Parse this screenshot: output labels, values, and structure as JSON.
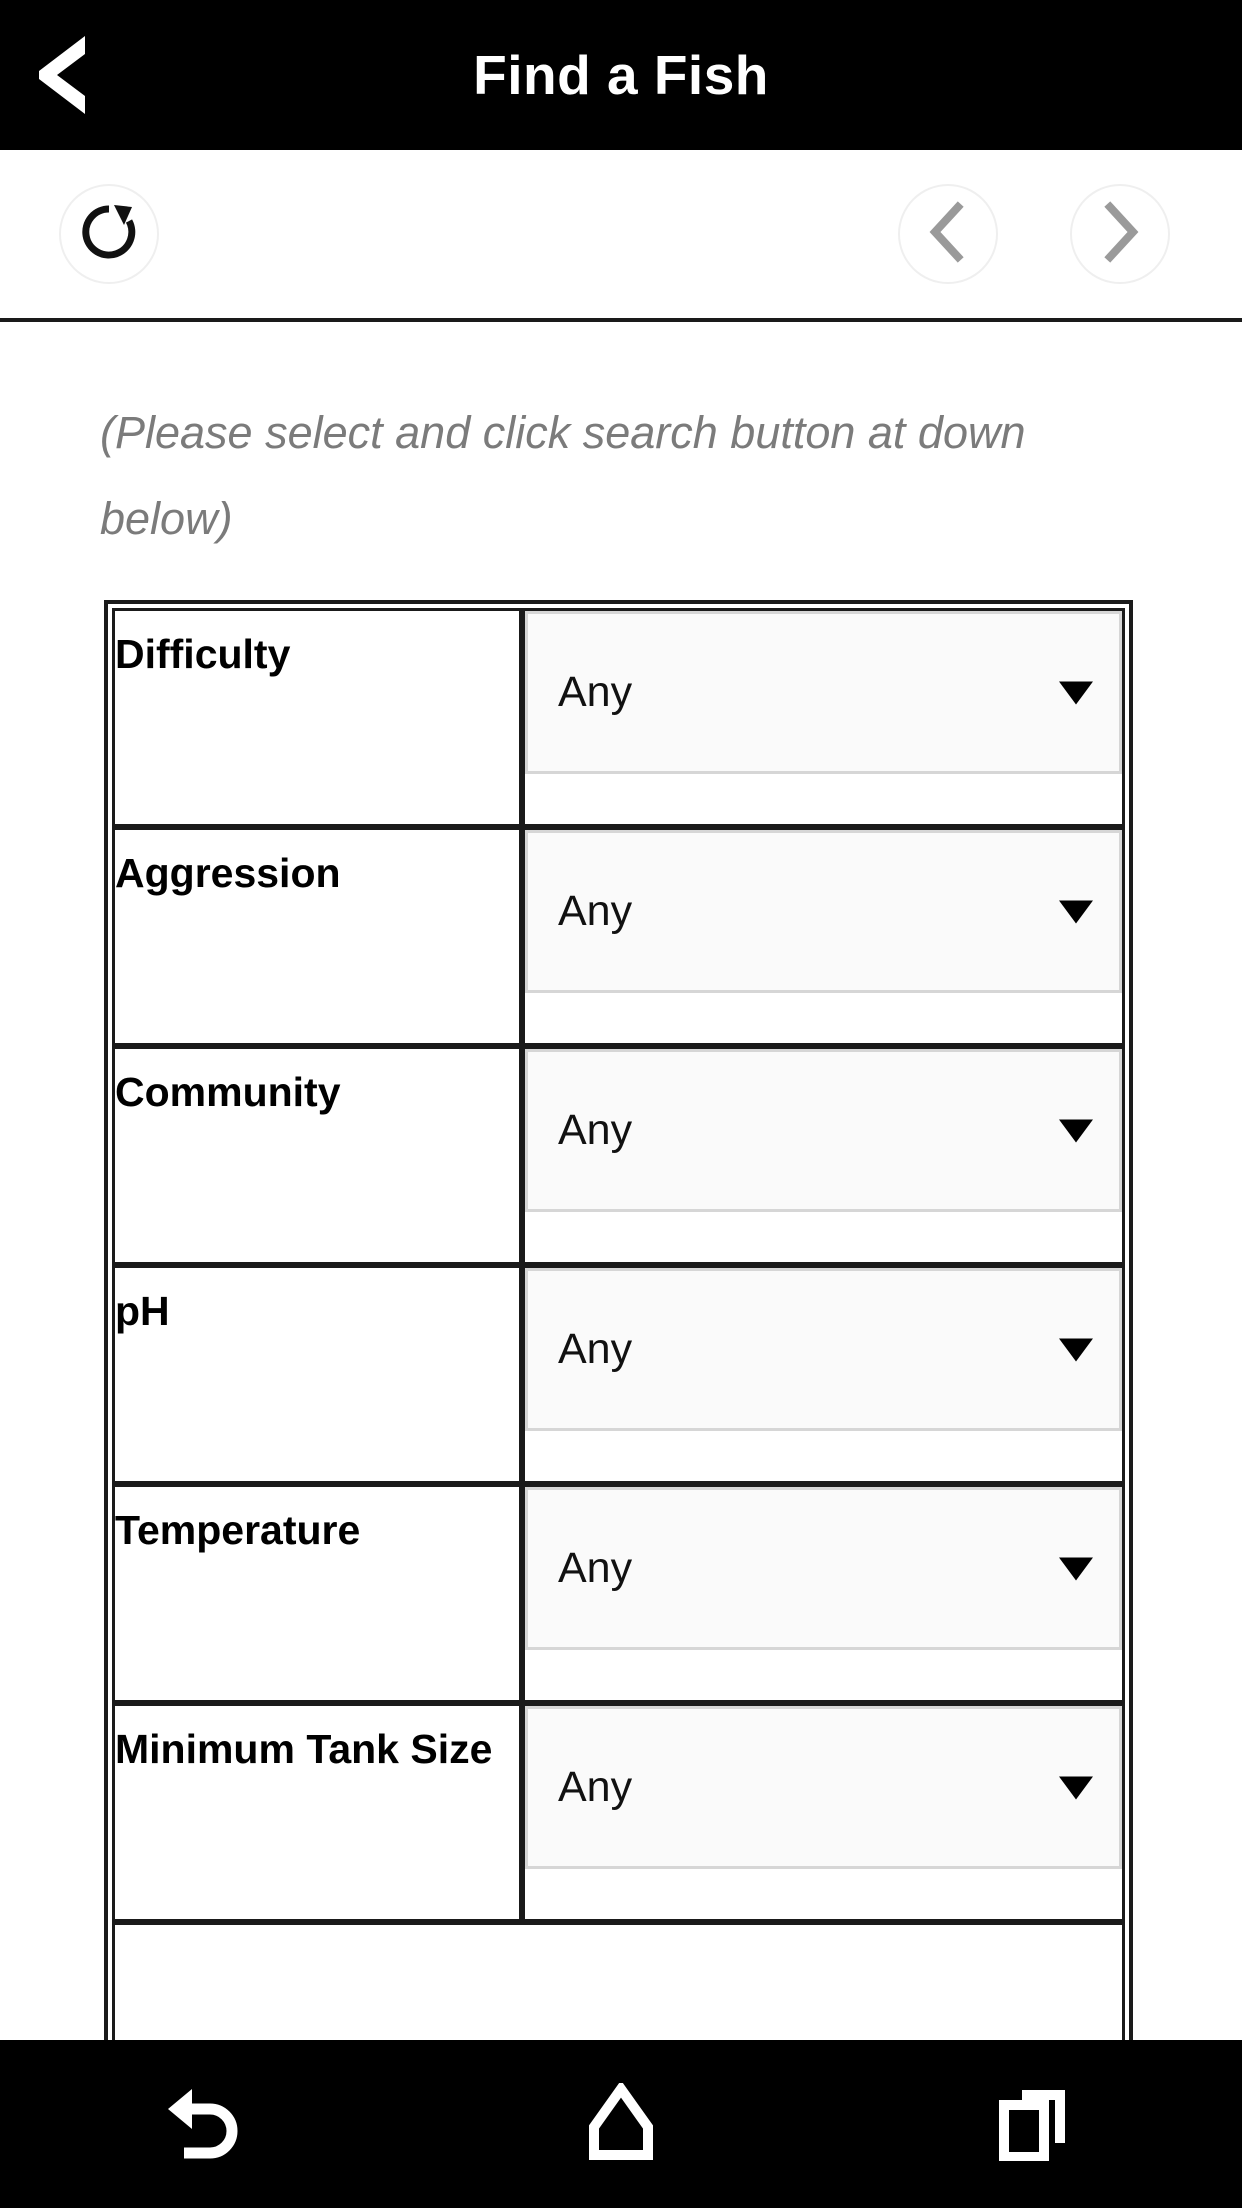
{
  "header": {
    "title": "Find a Fish",
    "back_icon": "chevron-left-icon"
  },
  "browser_toolbar": {
    "reload_icon": "refresh-icon",
    "nav_back_icon": "chevron-left-circle-icon",
    "nav_forward_icon": "chevron-right-circle-icon"
  },
  "content": {
    "hint": "(Please select and click search button at down below)",
    "filters": [
      {
        "label": "Difficulty",
        "value": "Any"
      },
      {
        "label": "Aggression",
        "value": "Any"
      },
      {
        "label": "Community",
        "value": "Any"
      },
      {
        "label": "pH",
        "value": "Any"
      },
      {
        "label": "Temperature",
        "value": "Any"
      },
      {
        "label": "Minimum Tank Size",
        "value": "Any"
      }
    ],
    "dropdown_arrow": "chevron-down-icon"
  },
  "nav_bar": {
    "back_icon": "back-arrow-icon",
    "home_icon": "home-icon",
    "recents_icon": "recents-icon"
  },
  "colors": {
    "header_bg": "#000000",
    "header_text": "#ffffff",
    "hint_text": "#7b7b7b",
    "table_border": "#1a1a1a",
    "select_border": "#d6d6d6",
    "select_bg": "#fafafa",
    "nav_bg": "#000000"
  }
}
